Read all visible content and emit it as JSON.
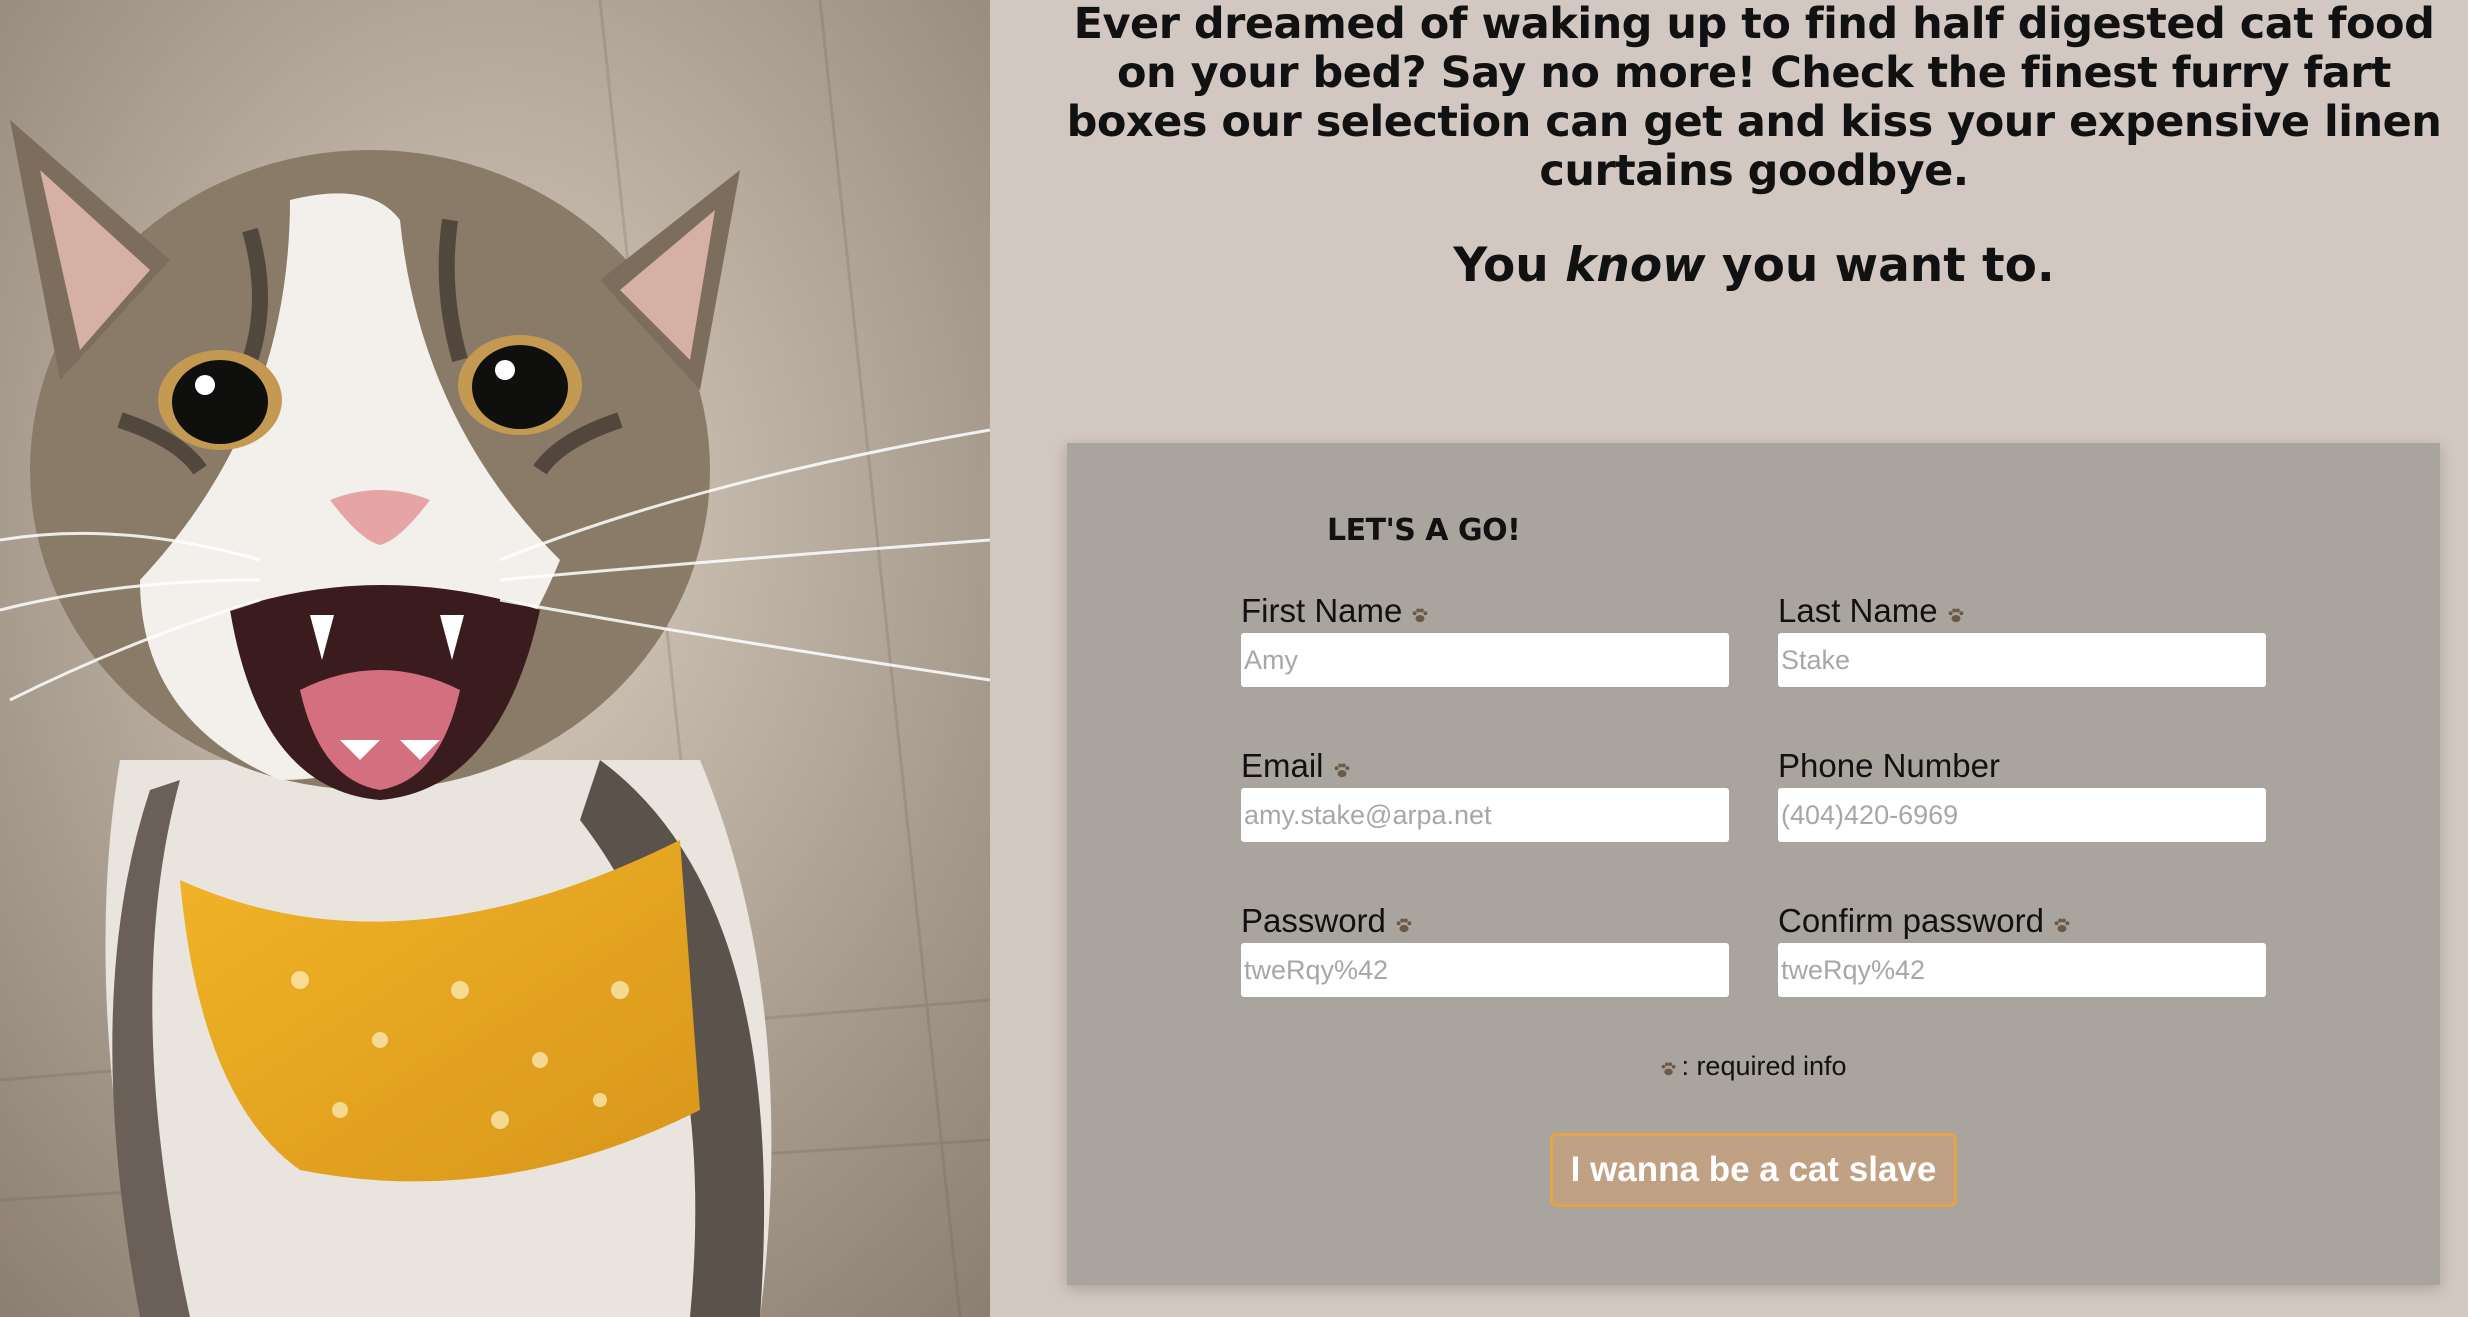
{
  "intro": {
    "text": "Ever dreamed of waking up to find half digested cat food on your bed? Say no more! Check the finest furry fart boxes our selection can get and kiss your expensive linen curtains goodbye.",
    "tagline_before": "You ",
    "tagline_emphasis": "know",
    "tagline_after": " you want to."
  },
  "form": {
    "title": "LET'S A GO!",
    "required_icon": "paw-icon",
    "fields": {
      "first_name": {
        "label": "First Name",
        "placeholder": "Amy",
        "required": true
      },
      "last_name": {
        "label": "Last Name",
        "placeholder": "Stake",
        "required": true
      },
      "email": {
        "label": "Email",
        "placeholder": "amy.stake@arpa.net",
        "required": true
      },
      "phone": {
        "label": "Phone Number",
        "placeholder": "(404)420-6969",
        "required": false
      },
      "password": {
        "label": "Password",
        "placeholder": "tweRqy%42",
        "required": true
      },
      "confirm_password": {
        "label": "Confirm password",
        "placeholder": "tweRqy%42",
        "required": true
      }
    },
    "required_note": ": required info",
    "submit_label": "I wanna be a cat slave"
  },
  "colors": {
    "page_bg": "#d2c7c1",
    "card_bg": "#aaa49e",
    "paw": "#6b5a48",
    "button_bg": "#c0a183",
    "button_border": "#e5a445"
  }
}
